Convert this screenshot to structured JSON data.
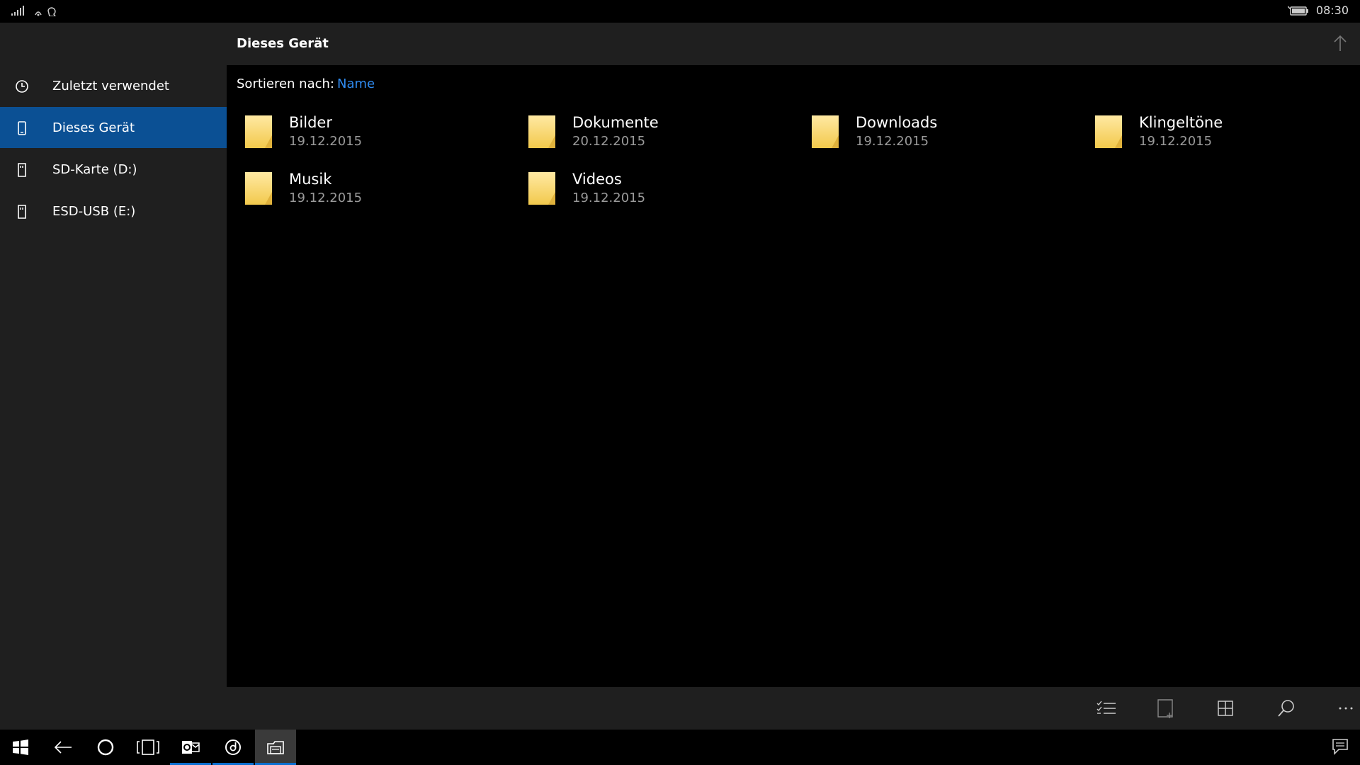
{
  "status": {
    "time": "08:30"
  },
  "sidebar": {
    "items": [
      {
        "label": "Zuletzt verwendet",
        "icon": "clock-icon",
        "active": false
      },
      {
        "label": "Dieses Gerät",
        "icon": "phone-icon",
        "active": true
      },
      {
        "label": "SD-Karte (D:)",
        "icon": "sd-card-icon",
        "active": false
      },
      {
        "label": "ESD-USB (E:)",
        "icon": "usb-drive-icon",
        "active": false
      }
    ]
  },
  "header": {
    "title": "Dieses Gerät"
  },
  "sort": {
    "label": "Sortieren nach:",
    "value": "Name"
  },
  "folders": [
    {
      "name": "Bilder",
      "date": "19.12.2015"
    },
    {
      "name": "Dokumente",
      "date": "20.12.2015"
    },
    {
      "name": "Downloads",
      "date": "19.12.2015"
    },
    {
      "name": "Klingeltöne",
      "date": "19.12.2015"
    },
    {
      "name": "Musik",
      "date": "19.12.2015"
    },
    {
      "name": "Videos",
      "date": "19.12.2015"
    }
  ],
  "commandbar": [
    "select-list-icon",
    "new-folder-icon",
    "grid-view-icon",
    "search-icon",
    "more-icon"
  ],
  "taskbar": [
    "windows-start-icon",
    "back-icon",
    "cortana-icon",
    "task-view-icon",
    "outlook-icon",
    "groove-music-icon",
    "file-explorer-icon"
  ],
  "colors": {
    "accent": "#0b5094",
    "link": "#2f8bf0",
    "folder": "#f8d775",
    "panel": "#1f1f1f"
  }
}
